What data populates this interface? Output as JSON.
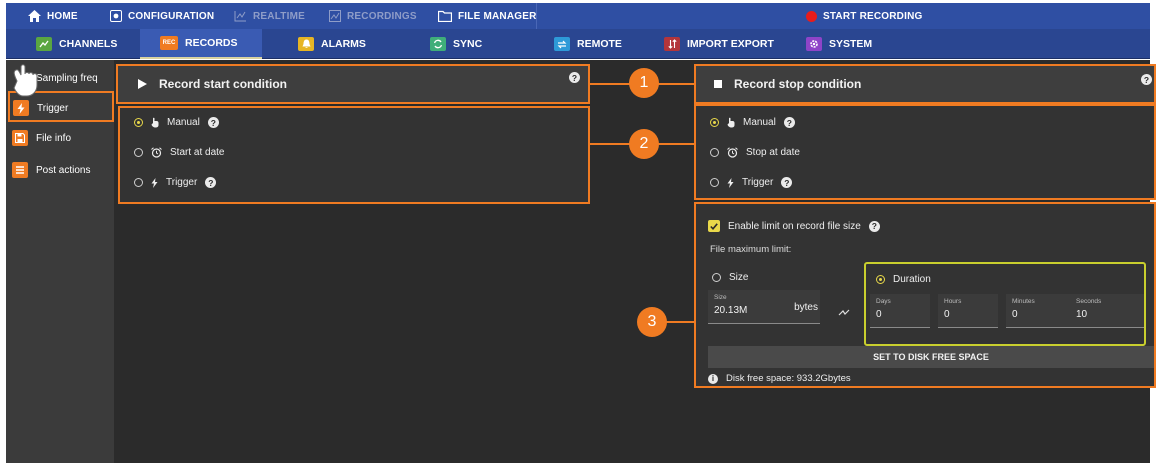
{
  "topnav": {
    "items": [
      {
        "label": "HOME",
        "icon": "home-icon"
      },
      {
        "label": "CONFIGURATION",
        "icon": "configuration-icon"
      },
      {
        "label": "REALTIME",
        "icon": "realtime-icon"
      },
      {
        "label": "RECORDINGS",
        "icon": "recordings-icon"
      },
      {
        "label": "FILE MANAGER",
        "icon": "folder-icon"
      }
    ],
    "start_recording": "START RECORDING",
    "record_color": "#e81c1c"
  },
  "subnav": {
    "items": [
      {
        "label": "CHANNELS",
        "icon": "channels-icon",
        "color": "#5aa641"
      },
      {
        "label": "RECORDS",
        "icon": "records-icon",
        "color": "#f07b22",
        "icon_text": "REC"
      },
      {
        "label": "ALARMS",
        "icon": "bell-icon",
        "color": "#e6b524"
      },
      {
        "label": "SYNC",
        "icon": "sync-icon",
        "color": "#3fae7a"
      },
      {
        "label": "REMOTE",
        "icon": "remote-icon",
        "color": "#2e9ad8"
      },
      {
        "label": "IMPORT EXPORT",
        "icon": "import-export-icon",
        "color": "#b3353b"
      },
      {
        "label": "SYSTEM",
        "icon": "gear-icon",
        "color": "#8e44c8"
      }
    ]
  },
  "sidebar": {
    "items": [
      {
        "label": "Sampling freq"
      },
      {
        "label": "Trigger"
      },
      {
        "label": "File info"
      },
      {
        "label": "Post actions"
      }
    ]
  },
  "start": {
    "title": "Record start condition",
    "options": [
      {
        "label": "Manual",
        "selected": true
      },
      {
        "label": "Start at date",
        "selected": false
      },
      {
        "label": "Trigger",
        "selected": false
      }
    ]
  },
  "stop": {
    "title": "Record stop condition",
    "options": [
      {
        "label": "Manual",
        "selected": true
      },
      {
        "label": "Stop at date",
        "selected": false
      },
      {
        "label": "Trigger",
        "selected": false
      }
    ]
  },
  "limit": {
    "enable_label": "Enable limit on record file size",
    "enabled": true,
    "max_label": "File maximum limit:",
    "size_option": "Size",
    "size_field_label": "Size",
    "size_value": "20.13M",
    "size_unit": "bytes",
    "duration_option": "Duration",
    "duration": [
      {
        "label": "Days",
        "value": "0"
      },
      {
        "label": "Hours",
        "value": "0"
      },
      {
        "label": "Minutes",
        "value": "0"
      },
      {
        "label": "Seconds",
        "value": "10"
      }
    ],
    "disk_button": "SET TO DISK FREE SPACE",
    "disk_free": "Disk free space:  933.2Gbytes"
  },
  "badges": [
    "1",
    "2",
    "3"
  ],
  "help_glyph": "?"
}
